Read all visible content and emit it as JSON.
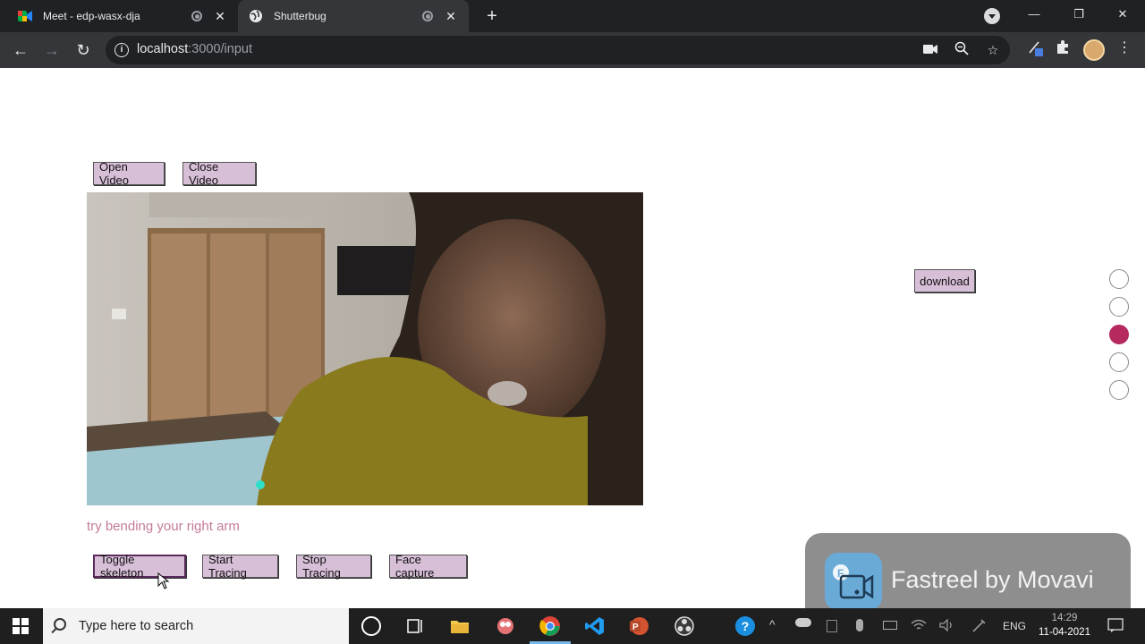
{
  "browser": {
    "tabs": [
      {
        "title": "Meet - edp-wasx-dja",
        "active": false
      },
      {
        "title": "Shutterbug",
        "active": true
      }
    ],
    "url_host": "localhost",
    "url_path": ":3000/input"
  },
  "page": {
    "video_controls": {
      "open_label": "Open Video",
      "close_label": "Close Video"
    },
    "download_label": "download",
    "instruction": "try bending your right arm",
    "bottom_controls": {
      "toggle_label": "Toggle skeleton",
      "start_label": "Start Tracing",
      "stop_label": "Stop Tracing",
      "face_label": "Face capture"
    },
    "progress_dots": {
      "total": 5,
      "active_index": 2,
      "active_color": "#b5295e"
    }
  },
  "overlay": {
    "text": "Fastreel by Movavi"
  },
  "taskbar": {
    "search_placeholder": "Type here to search",
    "language": "ENG",
    "time": "14:29",
    "date": "11-04-2021"
  }
}
